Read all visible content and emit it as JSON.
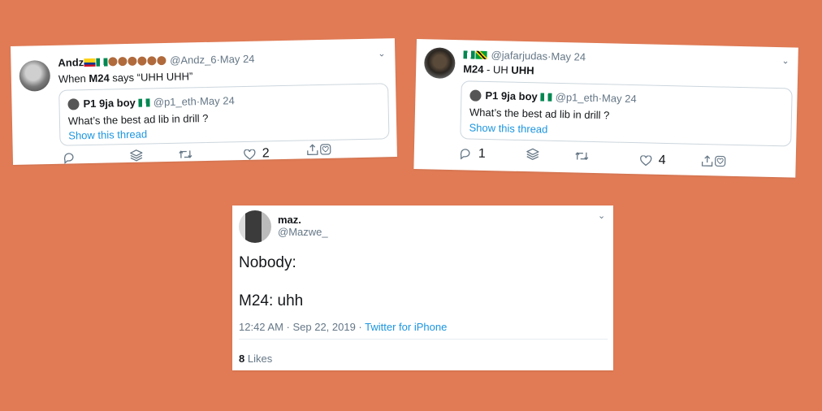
{
  "tweet1": {
    "author_name": "Andz",
    "handle": "@Andz_6",
    "date": "May 24",
    "text_prefix": "When ",
    "text_bold": "M24",
    "text_suffix": " says “UHH UHH”",
    "quote": {
      "author_name": "P1 9ja boy",
      "handle": "@p1_eth",
      "date": "May 24",
      "text": "What’s the best ad lib in drill ?",
      "link": "Show this thread"
    },
    "reply_count": "",
    "retweet_count": "",
    "like_count": "2"
  },
  "tweet2": {
    "handle": "@jafarjudas",
    "date": "May 24",
    "text_bold_1": "M24",
    "text_mid": " - UH ",
    "text_bold_2": "UHH",
    "quote": {
      "author_name": "P1 9ja boy",
      "handle": "@p1_eth",
      "date": "May 24",
      "text": "What’s the best ad lib in drill ?",
      "link": "Show this thread"
    },
    "reply_count": "1",
    "like_count": "4"
  },
  "tweet3": {
    "author_name": "maz.",
    "handle": "@Mazwe_",
    "line1": "Nobody:",
    "line2": "M24: uhh",
    "timestamp": "12:42 AM · Sep 22, 2019 · ",
    "source": "Twitter for iPhone",
    "likes_count": "8",
    "likes_label": " Likes"
  },
  "separator": " · ",
  "colors": {
    "background": "#E07B55",
    "link": "#1B95E0",
    "muted": "#657786"
  },
  "icons": [
    "chevron-down-icon",
    "reply-icon",
    "stack-icon",
    "retweet-icon",
    "like-icon",
    "share-icon",
    "heart-box-icon"
  ]
}
